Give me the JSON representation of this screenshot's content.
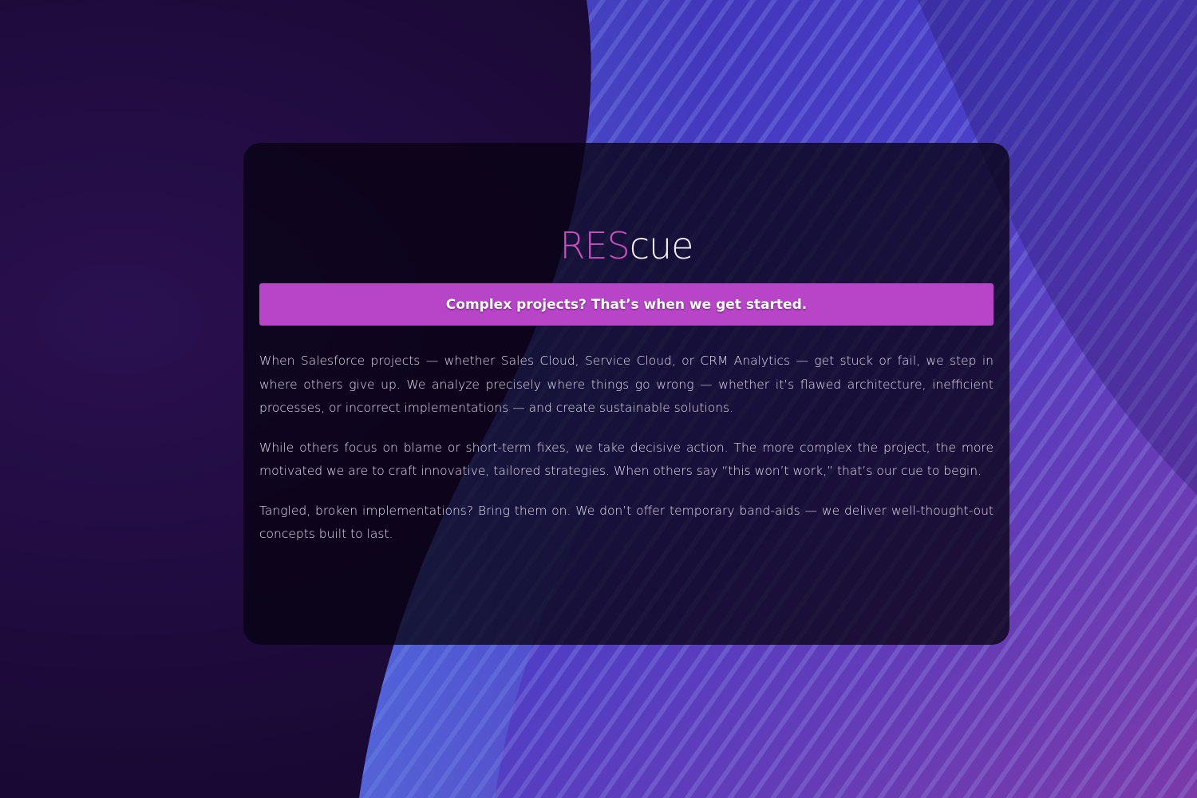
{
  "brand": {
    "part_highlight": "RES",
    "part_rest": "cue"
  },
  "tagline": "Complex projects? That’s when we get started.",
  "paragraphs": [
    "When Salesforce projects — whether Sales Cloud, Service Cloud, or CRM Analytics — get stuck or fail, we step in where others give up. We analyze precisely where things go wrong — whether it’s flawed architecture, inefficient processes, or incorrect implementations — and create sustainable solutions.",
    "While others focus on blame or short-term fixes, we take decisive action. The more complex the project, the more motivated we are to craft innovative, tailored strategies. When others say “this won’t work,” that’s our cue to begin.",
    "Tangled, broken implementations? Bring them on. We don’t offer temporary band-aids — we deliver well-thought-out concepts built to last."
  ],
  "colors": {
    "background": "#1c0a3a",
    "accent_magenta": "#b845c8",
    "brand_pink": "#c94fbf",
    "wave_blue": "#4a5fd8",
    "wave_purple": "#8a3fb8"
  }
}
